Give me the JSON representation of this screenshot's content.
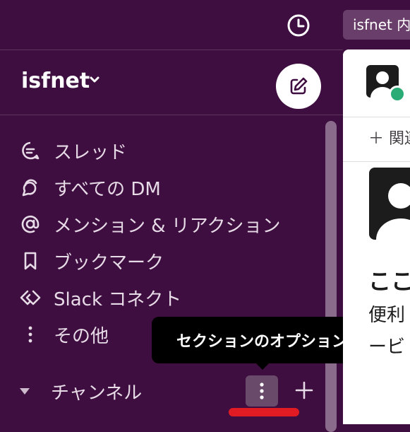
{
  "topbar": {
    "search_text": "isfnet 内"
  },
  "workspace": {
    "name": "isfnet"
  },
  "nav": {
    "items": [
      {
        "label": "スレッド",
        "icon": "threads-icon"
      },
      {
        "label": "すべての DM",
        "icon": "dm-icon"
      },
      {
        "label": "メンション & リアクション",
        "icon": "mention-icon"
      },
      {
        "label": "ブックマーク",
        "icon": "bookmark-icon"
      },
      {
        "label": "Slack コネクト",
        "icon": "slack-connect-icon"
      },
      {
        "label": "その他",
        "icon": "more-vertical-icon"
      }
    ]
  },
  "section": {
    "label": "チャンネル"
  },
  "tooltip": {
    "text": "セクションのオプション"
  },
  "main": {
    "related": "＋ 関連",
    "heading": "ここ",
    "text1": "便利",
    "text2": "ービ"
  },
  "colors": {
    "sidebar": "#3f0e40",
    "highlight": "#e01b24",
    "presence": "#2bac76"
  }
}
